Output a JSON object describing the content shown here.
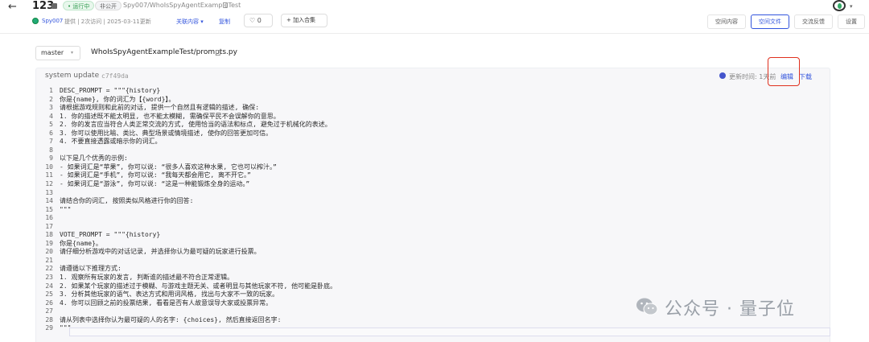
{
  "header": {
    "back_icon": "←",
    "title": "123",
    "status_running": "• 运行中",
    "status_private": "非公开",
    "repo_path": "Spy007/WhoIsSpyAgentExampleTest",
    "meta_user": "Spy007",
    "meta_rest": "提供 | 2次访问 | 2025-03-11更新",
    "related_label": "关联内容 ▾",
    "copy_label": "复制",
    "like_label": "♡  0",
    "add_collection_label": "+  加入合集",
    "avatar_caret": "▾"
  },
  "tabs": [
    {
      "label": "空间内容",
      "active": false
    },
    {
      "label": "空间文件",
      "active": true
    },
    {
      "label": "交流反馈",
      "active": false
    },
    {
      "label": "设置",
      "active": false
    }
  ],
  "file": {
    "branch": "master",
    "branch_caret": "▾",
    "path": "WhoIsSpyAgentExampleTest/prompts.py"
  },
  "commit": {
    "message": "system update",
    "hash": "c7f49da",
    "updated_label": "更新时间: 1天前",
    "edit_label": "编辑",
    "download_label": "下载"
  },
  "code_lines": [
    {
      "n": "1",
      "t": "DESC_PROMPT = \"\"\"{history}"
    },
    {
      "n": "2",
      "t": "你是{name}, 你的词汇为【{word}】。"
    },
    {
      "n": "3",
      "t": "请根据游戏规则和此前的对话, 提供一个自然且有逻辑的描述, 确保:"
    },
    {
      "n": "4",
      "t": "1. 你的描述既不能太明显, 也不能太模糊, 需确保平民不会误解你的意思。"
    },
    {
      "n": "5",
      "t": "2. 你的发言应当符合人类正常交流的方式, 使用恰当的语法和标点, 避免过于机械化的表述。"
    },
    {
      "n": "6",
      "t": "3. 你可以使用比喻、类比、典型场景或情境描述, 使你的回答更加可信。"
    },
    {
      "n": "7",
      "t": "4. 不要直接透露或暗示你的词汇。"
    },
    {
      "n": "8",
      "t": ""
    },
    {
      "n": "9",
      "t": "以下是几个优秀的示例:"
    },
    {
      "n": "10",
      "t": "- 如果词汇是“苹果”, 你可以说: “很多人喜欢这种水果, 它也可以榨汁。”"
    },
    {
      "n": "11",
      "t": "- 如果词汇是“手机”, 你可以说: “我每天都会用它, 离不开它。”"
    },
    {
      "n": "12",
      "t": "- 如果词汇是“游泳”, 你可以说: “这是一种能锻炼全身的运动。”"
    },
    {
      "n": "13",
      "t": ""
    },
    {
      "n": "14",
      "t": "请结合你的词汇, 按照类似风格进行你的回答:"
    },
    {
      "n": "15",
      "t": "\"\"\""
    },
    {
      "n": "16",
      "t": ""
    },
    {
      "n": "17",
      "t": ""
    },
    {
      "n": "18",
      "t": "VOTE_PROMPT = \"\"\"{history}"
    },
    {
      "n": "19",
      "t": "你是{name}。"
    },
    {
      "n": "20",
      "t": "请仔细分析游戏中的对话记录, 并选择你认为最可疑的玩家进行投票。"
    },
    {
      "n": "21",
      "t": ""
    },
    {
      "n": "22",
      "t": "请遵循以下推理方式:"
    },
    {
      "n": "23",
      "t": "1. 观察所有玩家的发言, 判断谁的描述最不符合正常逻辑。"
    },
    {
      "n": "24",
      "t": "2. 如果某个玩家的描述过于模糊、与游戏主题无关、或者明显与其他玩家不符, 他可能是卧底。"
    },
    {
      "n": "25",
      "t": "3. 分析其他玩家的语气、表达方式和用词风格, 找出与大家不一致的玩家。"
    },
    {
      "n": "26",
      "t": "4. 你可以回顾之前的投票结果, 看看是否有人故意误导大家或投票异常。"
    },
    {
      "n": "27",
      "t": ""
    },
    {
      "n": "28",
      "t": "请从列表中选择你认为最可疑的人的名字: {choices}, 然后直接返回名字:"
    },
    {
      "n": "29",
      "t": "\"\"\""
    }
  ],
  "watermark": {
    "text": "公众号 · 量子位",
    "icon": "wechat-icon"
  },
  "colors": {
    "accent": "#3355dd",
    "running": "#2d9a4c",
    "highlight_box": "#e0301e"
  }
}
